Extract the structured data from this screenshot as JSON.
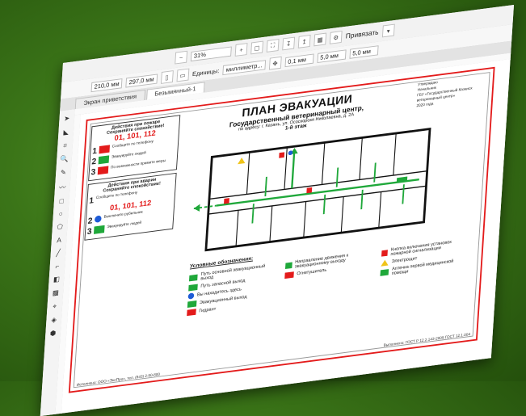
{
  "app": {
    "zoom": "31%",
    "units_label": "Единицы:",
    "units_value": "миллиметр...",
    "nudge": "0,1 мм",
    "snap_label": "Привязать",
    "dup_x": "5,0 мм",
    "dup_y": "5,0 мм",
    "width": "210,0 мм",
    "height": "297,0 мм"
  },
  "tabs": [
    {
      "label": "Экран приветствия"
    },
    {
      "label": "Безымянный-1"
    }
  ],
  "sheet": {
    "title": "ПЛАН ЭВАКУАЦИИ",
    "org": "Государственный ветеринарный центр,",
    "address": "по адресу: г. Казань, ул. Ососкорокя Николаевна, д. 2А",
    "floor": "1-й этаж",
    "approve": {
      "line1": "Утверждаю",
      "line2": "Начальник",
      "line3": "ГБУ «Государственный Казанск",
      "line4": "ветеринарный центр»",
      "line5": "2020 года"
    },
    "left_panel": {
      "fire_title": "Действия при пожаре",
      "fire_hint": "Сохраняйте спокойствие!",
      "fire_phones": "01, 101, 112",
      "accident_title": "Действия при аварии",
      "accident_hint": "Сохраняйте спокойствие!",
      "accident_phones": "01, 101, 112",
      "steps": [
        {
          "num": "1",
          "text": "Сообщите по телефону"
        },
        {
          "num": "2",
          "text": "Эвакуируйте людей"
        },
        {
          "num": "3",
          "text": "По возможности примите меры"
        }
      ],
      "steps2": [
        {
          "num": "1",
          "text": "Сообщите по телефону"
        },
        {
          "num": "2",
          "text": "Выключите рубильник"
        },
        {
          "num": "3",
          "text": "Эвакуируйте людей"
        }
      ]
    },
    "legend": {
      "title": "Условные обозначения:",
      "items": [
        {
          "icon": "green-arrow",
          "text": "Путь основной эвакуационный выход"
        },
        {
          "icon": "green-dashed",
          "text": "Путь запасной выход"
        },
        {
          "icon": "blue-dot",
          "text": "Вы находитесь здесь"
        },
        {
          "icon": "exit-sign",
          "text": "Эвакуационный выход"
        },
        {
          "icon": "fire-ext",
          "text": "Гидрант"
        },
        {
          "icon": "exit-door",
          "text": "Направление движения к эвакуационному выходу"
        },
        {
          "icon": "extinguisher",
          "text": "Огнетушитель"
        },
        {
          "icon": "alarm",
          "text": "Кнопка включения установок пожарной сигнализации"
        },
        {
          "icon": "electric",
          "text": "Электрощит"
        },
        {
          "icon": "firstaid",
          "text": "Аптечка первой медицинской помощи"
        }
      ]
    },
    "footer_left": "Исполнено: ООО «ЭкоПро», тел. (843) 2-50-800",
    "footer_right": "Выполнено: ГОСТ Р 12.2.143-2009 ГОСТ 12.1.004"
  },
  "colors": {
    "frame": "#e31b1b",
    "exit": "#1fa83a",
    "background": "#3b7518"
  }
}
